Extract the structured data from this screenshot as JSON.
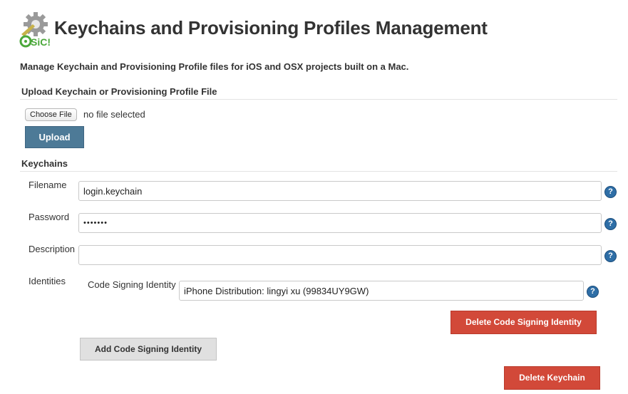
{
  "header": {
    "title": "Keychains and Provisioning Profiles Management",
    "logo_icon": "gear-sic-logo-icon",
    "logo_text": "SiC!",
    "description": "Manage Keychain and Provisioning Profile files for iOS and OSX projects built on a Mac."
  },
  "upload": {
    "section_title": "Upload Keychain or Provisioning Profile File",
    "choose_file_label": "Choose File",
    "no_file_text": "no file selected",
    "upload_button": "Upload"
  },
  "keychains": {
    "section_title": "Keychains",
    "filename_label": "Filename",
    "filename_value": "login.keychain",
    "password_label": "Password",
    "password_value": "•••••••",
    "description_label": "Description",
    "description_value": "",
    "identities_label": "Identities",
    "code_signing_identity_label": "Code Signing Identity",
    "code_signing_identity_value": "iPhone Distribution: lingyi xu (99834UY9GW)",
    "delete_identity_button": "Delete Code Signing Identity",
    "add_identity_button": "Add Code Signing Identity",
    "delete_keychain_button": "Delete Keychain",
    "help_icon": "?"
  },
  "colors": {
    "upload_button": "#4d7a97",
    "delete_button": "#d24939",
    "help_icon": "#2e6ea6",
    "logo_green": "#4ba83a"
  }
}
